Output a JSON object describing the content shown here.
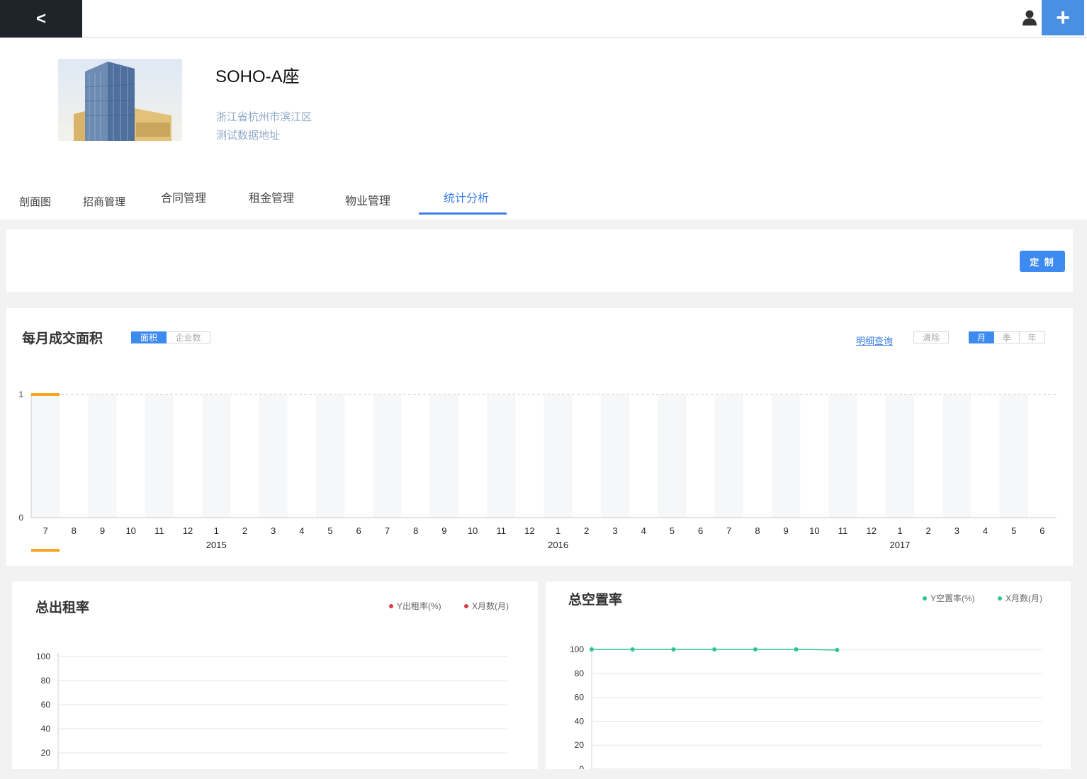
{
  "topbar": {
    "back_label": "<",
    "user_icon": "user-icon",
    "add_label": "+"
  },
  "building": {
    "title": "SOHO-A座",
    "address_line1": "浙江省杭州市滨江区",
    "address_line2": "测试数据地址"
  },
  "tabs": [
    {
      "label": "剖面图",
      "active": false
    },
    {
      "label": "招商管理",
      "active": false
    },
    {
      "label": "合同管理",
      "active": false
    },
    {
      "label": "租金管理",
      "active": false
    },
    {
      "label": "物业管理",
      "active": false
    },
    {
      "label": "统计分析",
      "active": true
    }
  ],
  "customize_label": "定 制",
  "monthly": {
    "title": "每月成交面积",
    "toggle": [
      {
        "label": "面积",
        "active": true
      },
      {
        "label": "企业数",
        "active": false
      }
    ],
    "detail_link": "明细查询",
    "clear_label": "清除",
    "period": [
      {
        "label": "月",
        "active": true
      },
      {
        "label": "季",
        "active": false
      },
      {
        "label": "年",
        "active": false
      }
    ]
  },
  "occupancy": {
    "title": "总出租率",
    "legend": [
      "Y出租率(%)",
      "X月数(月)"
    ],
    "color": "#e03a4a"
  },
  "vacancy": {
    "title": "总空置率",
    "legend": [
      "Y空置率(%)",
      "X月数(月)"
    ],
    "color": "#2fc48d"
  },
  "chart_data": [
    {
      "type": "bar",
      "title": "每月成交面积",
      "categories": [
        "7",
        "8",
        "9",
        "10",
        "11",
        "12",
        "1",
        "2",
        "3",
        "4",
        "5",
        "6",
        "7",
        "8",
        "9",
        "10",
        "11",
        "12",
        "1",
        "2",
        "3",
        "4",
        "5",
        "6",
        "7",
        "8",
        "9",
        "10",
        "11",
        "12",
        "1",
        "2",
        "3",
        "4",
        "5",
        "6"
      ],
      "year_labels": [
        {
          "label": "2015",
          "category_index": 6
        },
        {
          "label": "2016",
          "category_index": 18
        },
        {
          "label": "2017",
          "category_index": 30
        }
      ],
      "values": [
        0,
        0,
        0,
        0,
        0,
        0,
        0,
        0,
        0,
        0,
        0,
        0,
        0,
        0,
        0,
        0,
        0,
        0,
        0,
        0,
        0,
        0,
        0,
        0,
        0,
        0,
        0,
        0,
        0,
        0,
        0,
        0,
        0,
        0,
        0,
        0
      ],
      "yticks": [
        0,
        1
      ],
      "ylim": [
        0,
        1
      ],
      "highlight_color": "#f5a623"
    },
    {
      "type": "line",
      "title": "总出租率",
      "series": [],
      "yticks": [
        20,
        40,
        60,
        80,
        100
      ],
      "ylim": [
        0,
        100
      ]
    },
    {
      "type": "line",
      "title": "总空置率",
      "series": [
        {
          "name": "Y空置率(%)",
          "values": [
            100,
            100,
            100,
            100,
            100,
            100,
            99.5
          ]
        }
      ],
      "yticks": [
        0,
        20,
        40,
        60,
        80,
        100
      ],
      "ylim": [
        0,
        100
      ]
    }
  ]
}
